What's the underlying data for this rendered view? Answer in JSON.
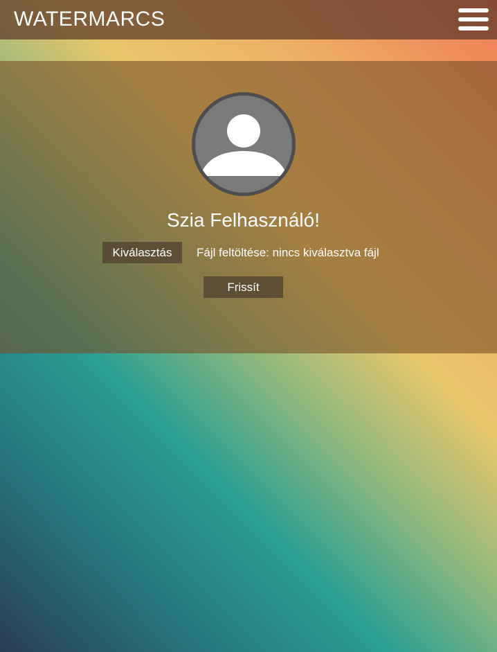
{
  "header": {
    "brand": "WATERMARCS",
    "menu_icon": "hamburger-menu-icon"
  },
  "profile": {
    "avatar_icon": "default-user-avatar-icon",
    "greeting": "Szia Felhasználó!",
    "choose_label": "Kiválasztás",
    "file_status": "Fájl feltöltése: nincs kiválasztva fájl",
    "refresh_label": "Frissít"
  },
  "colors": {
    "header_bg": "#5a3728",
    "button_bg": "#554832",
    "avatar_bg": "#7a7a7a",
    "avatar_border": "#4e4e4e",
    "text": "#ffffff"
  }
}
